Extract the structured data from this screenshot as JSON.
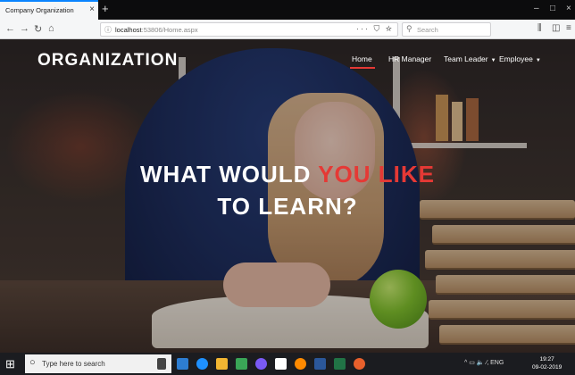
{
  "browser": {
    "tab_title": "Company Organization",
    "tab_close": "×",
    "new_tab": "+",
    "url_host": "localhost",
    "url_rest": ":53806/Home.aspx",
    "url_actions": "··· ⛉ ☆",
    "search_placeholder": "Search",
    "window_controls": [
      "–",
      "□",
      "×"
    ]
  },
  "site": {
    "brand": "ORGANIZATION",
    "menu": [
      {
        "label": "Home",
        "active": true
      },
      {
        "label": "HR Manager",
        "active": false
      },
      {
        "label": "Team Leader",
        "active": false,
        "dropdown": true
      },
      {
        "label": "Employee",
        "active": false,
        "dropdown": true
      }
    ],
    "headline_line1_part1": "WHAT WOULD ",
    "headline_line1_accent": "YOU LIKE",
    "headline_line2": "TO LEARN?",
    "accent_color": "#e53935"
  },
  "taskbar": {
    "search_placeholder": "Type here to search",
    "tray_text": "^ ▭ 🔈 ⁄‚ ENG",
    "time": "19:27",
    "date": "09-02-2019",
    "apps": [
      "mic-icon",
      "file-icon",
      "edge-icon",
      "explorer-icon",
      "store-icon",
      "chrome-icon",
      "app-icon",
      "firefox-icon",
      "word-icon",
      "excel-icon",
      "vs-icon"
    ]
  }
}
